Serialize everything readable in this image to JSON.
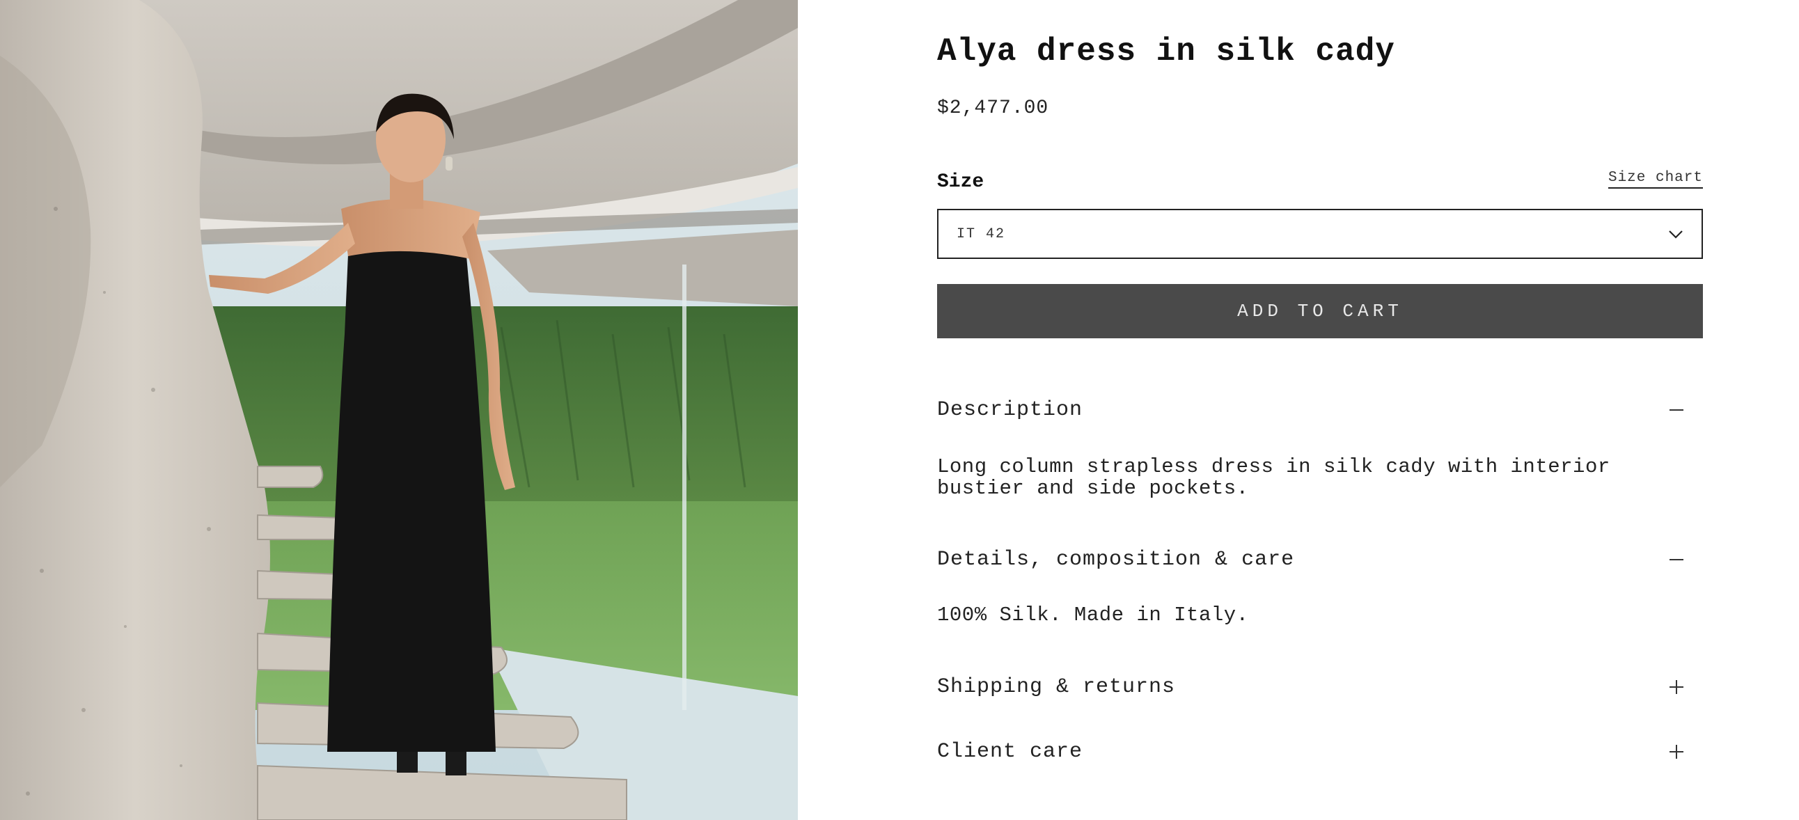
{
  "product": {
    "title": "Alya dress in silk cady",
    "price": "$2,477.00",
    "image_alt": "Model wearing black strapless column dress on a concrete spiral staircase"
  },
  "size": {
    "label": "Size",
    "chart_link": "Size chart",
    "selected": "IT 42",
    "dropdown_icon": "chevron-down-icon"
  },
  "cart": {
    "button_label": "ADD TO CART"
  },
  "accordion": [
    {
      "title": "Description",
      "expanded": true,
      "icon": "minus-icon",
      "content": "Long column strapless dress in silk cady with interior bustier and side pockets."
    },
    {
      "title": "Details, composition & care",
      "expanded": true,
      "icon": "minus-icon",
      "content": "100% Silk. Made in Italy."
    },
    {
      "title": "Shipping & returns",
      "expanded": false,
      "icon": "plus-icon"
    },
    {
      "title": "Client care",
      "expanded": false,
      "icon": "plus-icon"
    }
  ],
  "colors": {
    "button_bg": "#4a4a4a",
    "button_text": "#e8e8e8",
    "text": "#1a1a1a"
  }
}
